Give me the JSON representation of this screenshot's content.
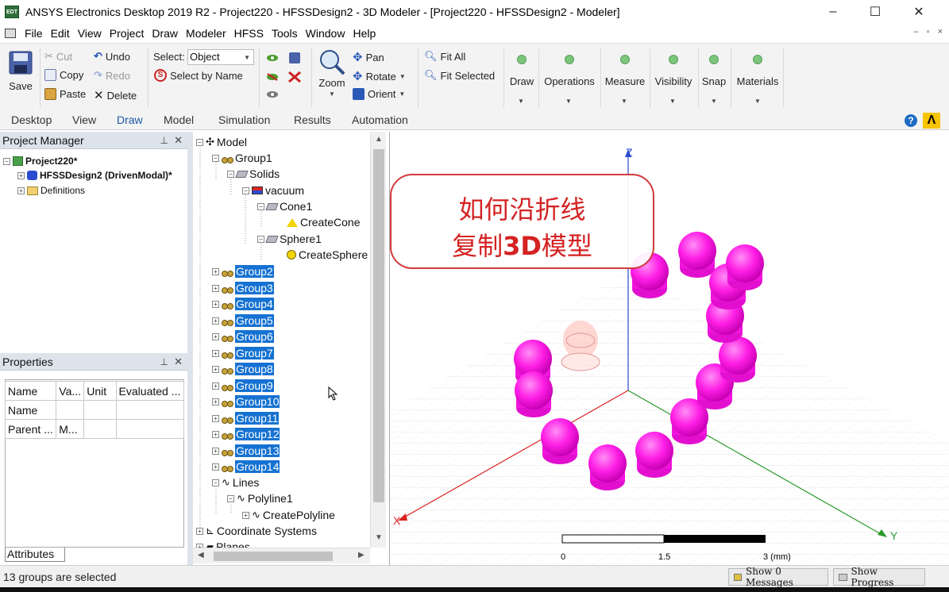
{
  "window": {
    "app_icon": "EDT",
    "title": "ANSYS Electronics Desktop 2019 R2 - Project220 - HFSSDesign2 - 3D Modeler - [Project220 - HFSSDesign2 - Modeler]",
    "minimize": "–",
    "maximize": "☐",
    "close": "✕"
  },
  "menu": {
    "items": [
      "File",
      "Edit",
      "View",
      "Project",
      "Draw",
      "Modeler",
      "HFSS",
      "Tools",
      "Window",
      "Help"
    ],
    "mdi": [
      "–",
      "▫",
      "×"
    ]
  },
  "ribbon": {
    "save": "Save",
    "cut": "Cut",
    "copy": "Copy",
    "paste": "Paste",
    "undo": "Undo",
    "redo": "Redo",
    "delete": "Delete",
    "select_label": "Select:",
    "select_value": "Object",
    "select_by_name": "Select by Name",
    "zoom": "Zoom",
    "pan": "Pan",
    "rotate": "Rotate",
    "orient": "Orient",
    "fit_all": "Fit All",
    "fit_selected": "Fit Selected",
    "groups": [
      "Draw",
      "Operations",
      "Measure",
      "Visibility",
      "Snap",
      "Materials"
    ]
  },
  "ribbon_tabs": {
    "items": [
      "Desktop",
      "View",
      "Draw",
      "Model",
      "Simulation",
      "Results",
      "Automation"
    ],
    "active": "Draw",
    "help": "?",
    "logo": "Λ"
  },
  "project_manager": {
    "title": "Project Manager",
    "pin": "⊥",
    "close": "✕",
    "project": "Project220*",
    "design": "HFSSDesign2 (DrivenModal)*",
    "definitions": "Definitions"
  },
  "properties": {
    "title": "Properties",
    "pin": "⊥",
    "close": "✕",
    "headers": [
      "Name",
      "Va...",
      "Unit",
      "Evaluated ..."
    ],
    "rows": [
      [
        "Name",
        "",
        "",
        ""
      ],
      [
        "Parent ...",
        "M...",
        "",
        ""
      ]
    ],
    "attributes_tab": "Attributes"
  },
  "model_tree": {
    "root": "Model",
    "group1": "Group1",
    "solids": "Solids",
    "vacuum": "vacuum",
    "cone": "Cone1",
    "create_cone": "CreateCone",
    "sphere": "Sphere1",
    "create_sphere": "CreateSphere",
    "selected_groups": [
      "Group2",
      "Group3",
      "Group4",
      "Group5",
      "Group6",
      "Group7",
      "Group8",
      "Group9",
      "Group10",
      "Group11",
      "Group12",
      "Group13",
      "Group14"
    ],
    "lines": "Lines",
    "polyline": "Polyline1",
    "create_polyline": "CreatePolyline",
    "coordinate_systems": "Coordinate Systems",
    "planes": "Planes"
  },
  "viewport": {
    "callout_line1": "如何沿折线",
    "callout_pre": "复制",
    "callout_bold": "3D",
    "callout_post": "模型",
    "axis_z": "Z",
    "axis_x": "X",
    "axis_y": "Y",
    "scale_labels": [
      "0",
      "1.5",
      "3 (mm)"
    ],
    "accent": "#ff1fe6",
    "callout_color": "#d42222"
  },
  "status": {
    "text": "13 groups are selected",
    "show_messages": "Show 0 Messages",
    "show_progress": "Show Progress"
  }
}
